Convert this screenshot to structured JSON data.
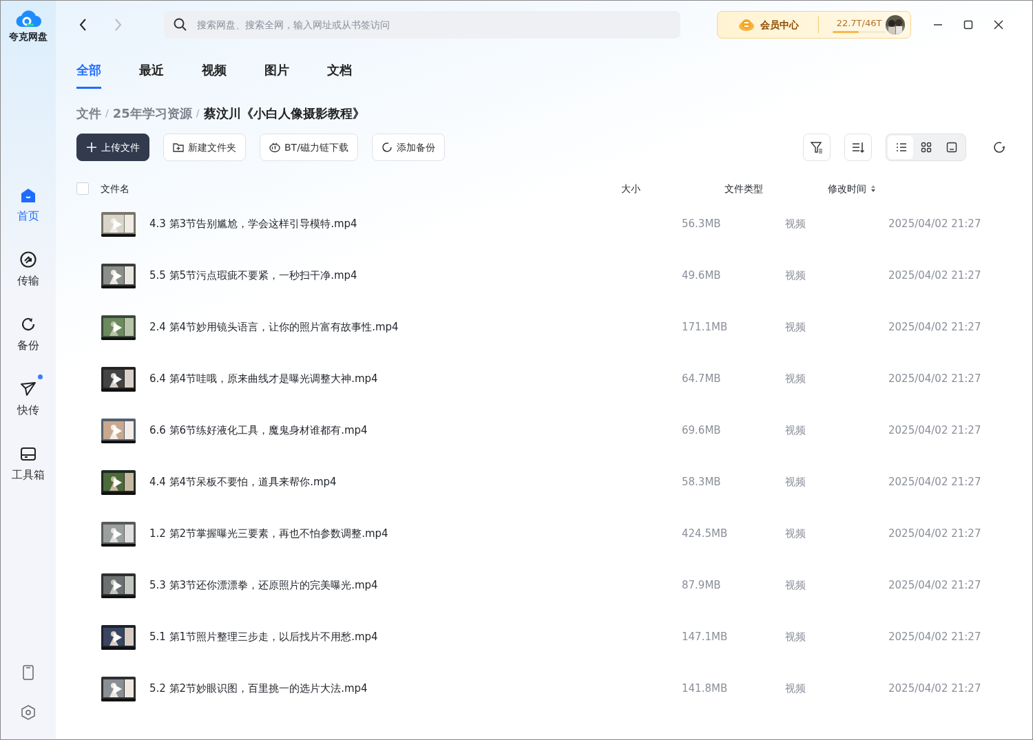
{
  "app": {
    "name": "夸克网盘"
  },
  "search": {
    "placeholder": "搜索网盘、搜索全网，输入网址或从书签访问"
  },
  "vip": {
    "label": "会员中心",
    "storage": "22.7T/46T",
    "level": 0.49
  },
  "sidebar": [
    {
      "kind": "home",
      "label": "首页",
      "selected": true,
      "dot": false
    },
    {
      "kind": "transfer",
      "label": "传输",
      "selected": false,
      "dot": false
    },
    {
      "kind": "backup",
      "label": "备份",
      "selected": false,
      "dot": false
    },
    {
      "kind": "send",
      "label": "快传",
      "selected": false,
      "dot": true
    },
    {
      "kind": "toolbox",
      "label": "工具箱",
      "selected": false,
      "dot": false
    }
  ],
  "tabs": [
    {
      "label": "全部",
      "selected": true
    },
    {
      "label": "最近",
      "selected": false
    },
    {
      "label": "视频",
      "selected": false
    },
    {
      "label": "图片",
      "selected": false
    },
    {
      "label": "文档",
      "selected": false
    }
  ],
  "breadcrumb": {
    "separator": "/",
    "items": [
      "文件",
      "25年学习资源",
      "蔡汶川《小白人像摄影教程》"
    ]
  },
  "actions": [
    {
      "kind": "upload",
      "label": "上传文件"
    },
    {
      "kind": "folder",
      "label": "新建文件夹"
    },
    {
      "kind": "bt",
      "label": "BT/磁力链下载"
    },
    {
      "kind": "backup",
      "label": "添加备份"
    }
  ],
  "views": [
    {
      "kind": "list",
      "selected": true
    },
    {
      "kind": "grid",
      "selected": false
    },
    {
      "kind": "large",
      "selected": false
    }
  ],
  "table": {
    "select_all": {
      "checked": false
    },
    "columns": [
      "文件名",
      "大小",
      "文件类型",
      "修改时间"
    ],
    "rows": [
      {
        "name": "4.3 第3节告别尴尬，学会这样引导模特.mp4",
        "size": "56.3MB",
        "type": "视频",
        "time": "2025/04/02 21:27"
      },
      {
        "name": "5.5 第5节污点瑕疵不要紧，一秒扫干净.mp4",
        "size": "49.6MB",
        "type": "视频",
        "time": "2025/04/02 21:27"
      },
      {
        "name": "2.4 第4节妙用镜头语言，让你的照片富有故事性.mp4",
        "size": "171.1MB",
        "type": "视频",
        "time": "2025/04/02 21:27"
      },
      {
        "name": "6.4 第4节哇哦，原来曲线才是曝光调整大神.mp4",
        "size": "64.7MB",
        "type": "视频",
        "time": "2025/04/02 21:27"
      },
      {
        "name": "6.6 第6节练好液化工具，魔鬼身材谁都有.mp4",
        "size": "69.6MB",
        "type": "视频",
        "time": "2025/04/02 21:27"
      },
      {
        "name": "4.4 第4节呆板不要怕，道具来帮你.mp4",
        "size": "58.3MB",
        "type": "视频",
        "time": "2025/04/02 21:27"
      },
      {
        "name": "1.2 第2节掌握曝光三要素，再也不怕参数调整.mp4",
        "size": "424.5MB",
        "type": "视频",
        "time": "2025/04/02 21:27"
      },
      {
        "name": "5.3 第3节还你漂漂拳，还原照片的完美曝光.mp4",
        "size": "87.9MB",
        "type": "视频",
        "time": "2025/04/02 21:27"
      },
      {
        "name": "5.1 第1节照片整理三步走，以后找片不用愁.mp4",
        "size": "147.1MB",
        "type": "视频",
        "time": "2025/04/02 21:27"
      },
      {
        "name": "5.2 第2节妙眼识图，百里挑一的选片大法.mp4",
        "size": "141.8MB",
        "type": "视频",
        "time": "2025/04/02 21:27"
      }
    ]
  }
}
